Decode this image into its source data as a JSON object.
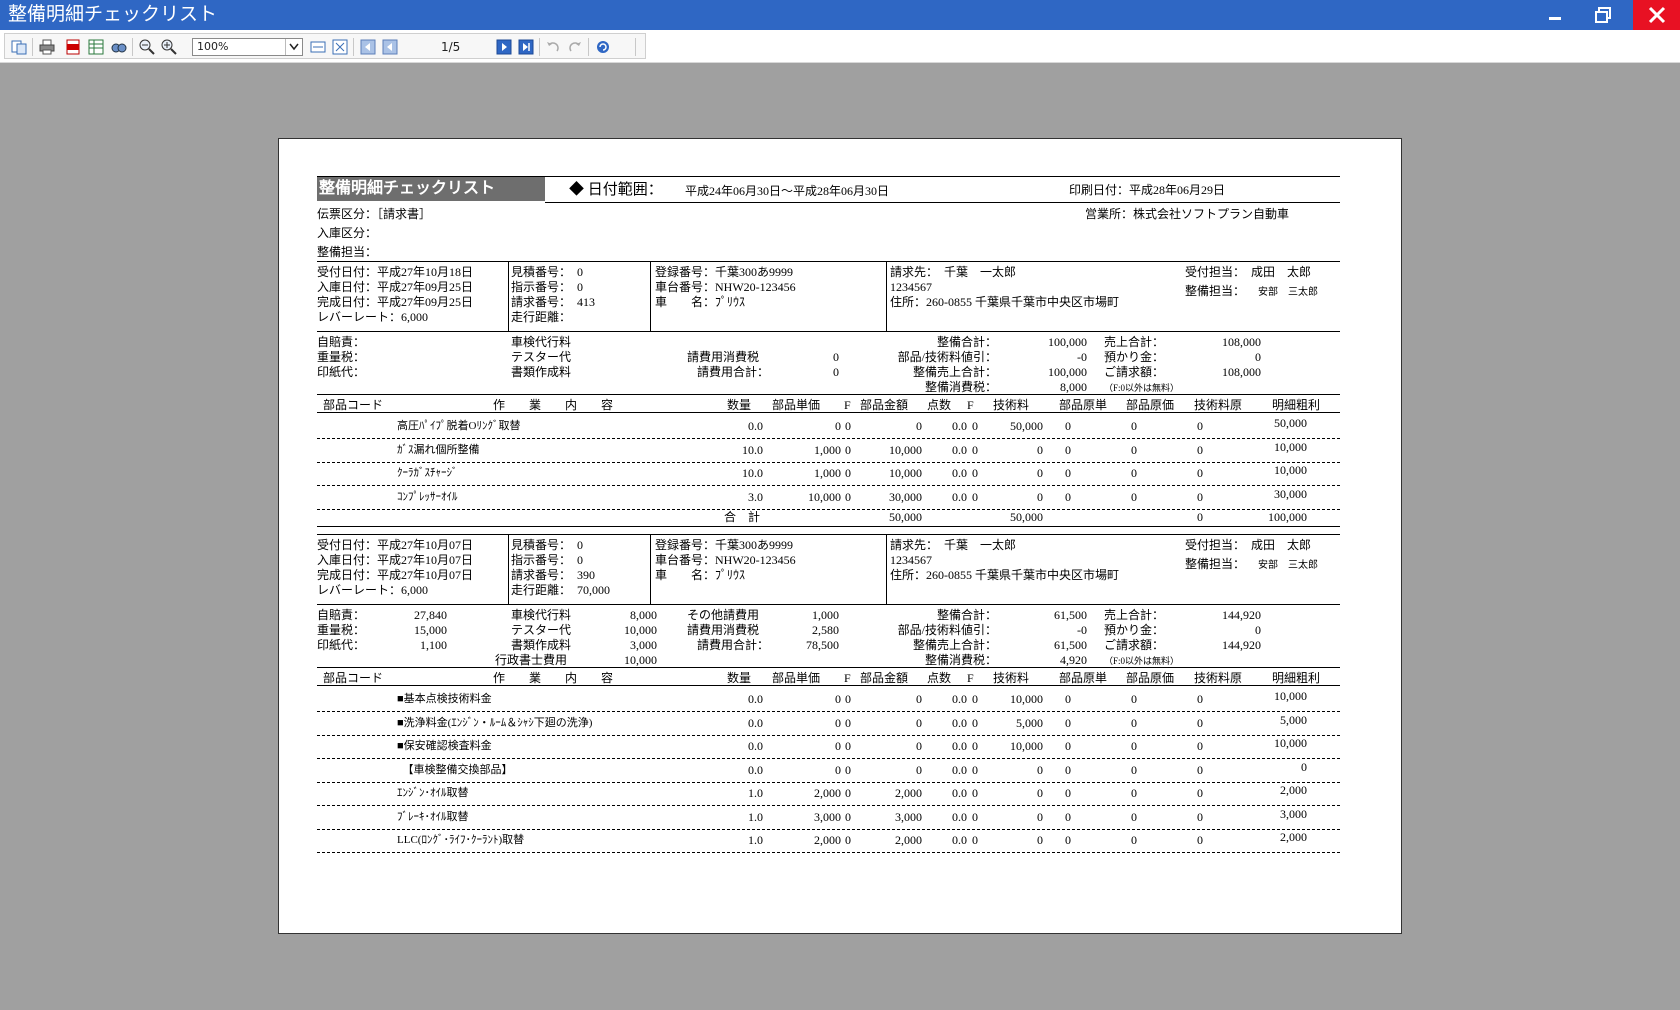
{
  "window": {
    "title": "整備明細チェックリスト"
  },
  "toolbar": {
    "zoom": "100%",
    "page": "1/5"
  },
  "report": {
    "title": "整備明細チェックリスト",
    "date_range_label": "◆ 日付範囲：",
    "date_range": "平成24年06月30日～平成28年06月30日",
    "print_date": "印刷日付：平成28年06月29日",
    "voucher_type": "伝票区分：［請求書］",
    "entry_type": "入庫区分：",
    "maintenance_staff": "整備担当：",
    "branch": "営業所：株式会社ソフトプラン自動車",
    "columns": [
      "部品コード",
      "作　　業　　内　　容",
      "数量",
      "部品単価",
      "F",
      "部品金額",
      "点数",
      "F",
      "技術料",
      "部品原単",
      "部品原価",
      "技術料原",
      "明細粗利"
    ],
    "total_label": "合　計",
    "f_note": "（F:0以外は無料）",
    "blocks": [
      {
        "info_left": [
          "受付日付：平成27年10月18日",
          "入庫日付：平成27年09月25日",
          "完成日付：平成27年09月25日",
          "レバーレート：6,000"
        ],
        "info_mid": [
          "見積番号：　0",
          "指示番号：　0",
          "請求番号：　413",
          "走行距離："
        ],
        "info_vehicle": [
          "登録番号：千葉300あ9999",
          "車台番号：NHW20-123456",
          "車　　名：ﾌﾟﾘｳｽ"
        ],
        "bill_to": "請求先：　千葉　一太郎",
        "postal": "1234567",
        "address": "住所：260-0855 千葉県千葉市中央区市場町",
        "recv_staff": "受付担当：　成田　太郎",
        "maint_staff_label": "整備担当：",
        "maint_staff": "安部　三太郎",
        "fees": [
          {
            "label": "自賠責：",
            "value": ""
          },
          {
            "label": "重量税：",
            "value": ""
          },
          {
            "label": "印紙代：",
            "value": ""
          },
          {
            "label": "車検代行料",
            "value": ""
          },
          {
            "label": "テスター代",
            "value": ""
          },
          {
            "label": "書類作成料",
            "value": ""
          }
        ],
        "fees_b": [
          {
            "label": "",
            "value": ""
          },
          {
            "label": "請費用消費税",
            "value": "0"
          },
          {
            "label": "請費用合計：",
            "value": "0"
          }
        ],
        "sums": [
          {
            "label": "整備合計：",
            "value": "100,000"
          },
          {
            "label": "部品/技術料値引：",
            "value": "-0"
          },
          {
            "label": "整備売上合計：",
            "value": "100,000"
          },
          {
            "label": "整備消費税：",
            "value": "8,000"
          }
        ],
        "sales": [
          {
            "label": "売上合計：",
            "value": "108,000"
          },
          {
            "label": "預かり金：",
            "value": "0"
          },
          {
            "label": "ご請求額：",
            "value": "108,000"
          }
        ],
        "rows": [
          {
            "name": "高圧ﾊﾟｲﾌﾟ脱着Oﾘﾝｸﾞ取替",
            "qty": "0.0",
            "unit": "0",
            "f1": "0",
            "amount": "0",
            "pts": "0.0",
            "f2": "0",
            "tech": "50,000",
            "pu": "0",
            "pc": "0",
            "tc": "0",
            "profit": "50,000"
          },
          {
            "name": "ｶﾞｽ漏れ個所整備",
            "qty": "10.0",
            "unit": "1,000",
            "f1": "0",
            "amount": "10,000",
            "pts": "0.0",
            "f2": "0",
            "tech": "0",
            "pu": "0",
            "pc": "0",
            "tc": "0",
            "profit": "10,000"
          },
          {
            "name": "ｸｰﾗｶﾞｽﾁｬｰｼﾞ",
            "qty": "10.0",
            "unit": "1,000",
            "f1": "0",
            "amount": "10,000",
            "pts": "0.0",
            "f2": "0",
            "tech": "0",
            "pu": "0",
            "pc": "0",
            "tc": "0",
            "profit": "10,000"
          },
          {
            "name": "ｺﾝﾌﾟﾚｯｻｰｵｲﾙ",
            "qty": "3.0",
            "unit": "10,000",
            "f1": "0",
            "amount": "30,000",
            "pts": "0.0",
            "f2": "0",
            "tech": "0",
            "pu": "0",
            "pc": "0",
            "tc": "0",
            "profit": "30,000"
          }
        ],
        "totals": {
          "amount": "50,000",
          "tech": "50,000",
          "tc": "0",
          "profit": "100,000"
        }
      },
      {
        "info_left": [
          "受付日付：平成27年10月07日",
          "入庫日付：平成27年10月07日",
          "完成日付：平成27年10月07日",
          "レバーレート：6,000"
        ],
        "info_mid": [
          "見積番号：　0",
          "指示番号：　0",
          "請求番号：　390",
          "走行距離：　70,000"
        ],
        "info_vehicle": [
          "登録番号：千葉300あ9999",
          "車台番号：NHW20-123456",
          "車　　名：ﾌﾟﾘｳｽ"
        ],
        "bill_to": "請求先：　千葉　一太郎",
        "postal": "1234567",
        "address": "住所：260-0855 千葉県千葉市中央区市場町",
        "recv_staff": "受付担当：　成田　太郎",
        "maint_staff_label": "整備担当：",
        "maint_staff": "安部　三太郎",
        "fees": [
          {
            "label": "自賠責：",
            "value": "27,840"
          },
          {
            "label": "重量税：",
            "value": "15,000"
          },
          {
            "label": "印紙代：",
            "value": "1,100"
          },
          {
            "label": "車検代行料",
            "value": "8,000"
          },
          {
            "label": "テスター代",
            "value": "10,000"
          },
          {
            "label": "書類作成料",
            "value": "3,000"
          },
          {
            "label": "行政書士費用",
            "value": "10,000"
          }
        ],
        "fees_b": [
          {
            "label": "その他請費用",
            "value": "1,000"
          },
          {
            "label": "請費用消費税",
            "value": "2,580"
          },
          {
            "label": "請費用合計：",
            "value": "78,500"
          }
        ],
        "sums": [
          {
            "label": "整備合計：",
            "value": "61,500"
          },
          {
            "label": "部品/技術料値引：",
            "value": "-0"
          },
          {
            "label": "整備売上合計：",
            "value": "61,500"
          },
          {
            "label": "整備消費税：",
            "value": "4,920"
          }
        ],
        "sales": [
          {
            "label": "売上合計：",
            "value": "144,920"
          },
          {
            "label": "預かり金：",
            "value": "0"
          },
          {
            "label": "ご請求額：",
            "value": "144,920"
          }
        ],
        "rows": [
          {
            "name": "■基本点検技術料金",
            "qty": "0.0",
            "unit": "0",
            "f1": "0",
            "amount": "0",
            "pts": "0.0",
            "f2": "0",
            "tech": "10,000",
            "pu": "0",
            "pc": "0",
            "tc": "0",
            "profit": "10,000"
          },
          {
            "name": "■洗浄料金(ｴﾝｼﾞﾝ・ﾙｰﾑ＆ｼｬｼ下廻の洗浄)",
            "qty": "0.0",
            "unit": "0",
            "f1": "0",
            "amount": "0",
            "pts": "0.0",
            "f2": "0",
            "tech": "5,000",
            "pu": "0",
            "pc": "0",
            "tc": "0",
            "profit": "5,000"
          },
          {
            "name": "■保安確認検査料金",
            "qty": "0.0",
            "unit": "0",
            "f1": "0",
            "amount": "0",
            "pts": "0.0",
            "f2": "0",
            "tech": "10,000",
            "pu": "0",
            "pc": "0",
            "tc": "0",
            "profit": "10,000"
          },
          {
            "name": "　【車検整備交換部品】",
            "qty": "0.0",
            "unit": "0",
            "f1": "0",
            "amount": "0",
            "pts": "0.0",
            "f2": "0",
            "tech": "0",
            "pu": "0",
            "pc": "0",
            "tc": "0",
            "profit": "0"
          },
          {
            "name": "ｴﾝｼﾞﾝ･ｵｲﾙ取替",
            "qty": "1.0",
            "unit": "2,000",
            "f1": "0",
            "amount": "2,000",
            "pts": "0.0",
            "f2": "0",
            "tech": "0",
            "pu": "0",
            "pc": "0",
            "tc": "0",
            "profit": "2,000"
          },
          {
            "name": "ﾌﾞﾚｰｷ･ｵｲﾙ取替",
            "qty": "1.0",
            "unit": "3,000",
            "f1": "0",
            "amount": "3,000",
            "pts": "0.0",
            "f2": "0",
            "tech": "0",
            "pu": "0",
            "pc": "0",
            "tc": "0",
            "profit": "3,000"
          },
          {
            "name": "LLC(ﾛﾝｸﾞ･ﾗｲﾌ･ｸｰﾗﾝﾄ)取替",
            "qty": "1.0",
            "unit": "2,000",
            "f1": "0",
            "amount": "2,000",
            "pts": "0.0",
            "f2": "0",
            "tech": "0",
            "pu": "0",
            "pc": "0",
            "tc": "0",
            "profit": "2,000"
          }
        ]
      }
    ]
  }
}
